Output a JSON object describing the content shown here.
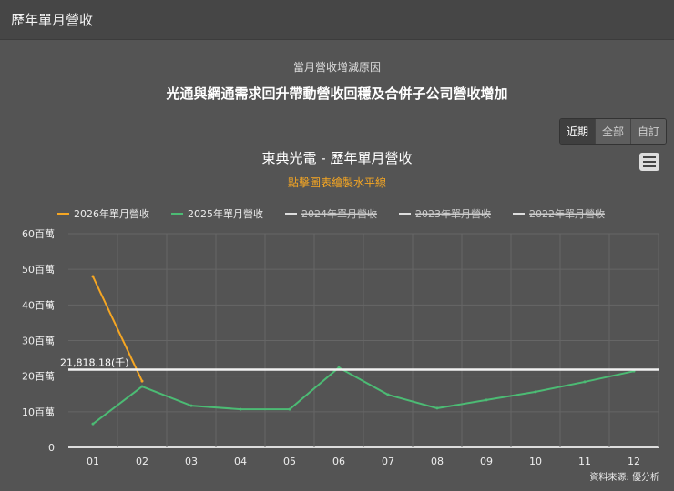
{
  "header": {
    "title": "歷年單月營收"
  },
  "subtitle": "當月營收增減原因",
  "reason": "光通與網通需求回升帶動營收回穩及合併子公司營收增加",
  "range_buttons": [
    "近期",
    "全部",
    "自訂"
  ],
  "chart_title": "東典光電 - 歷年單月營收",
  "chart_hint": "點擊圖表繪製水平線",
  "source": "資料來源: 優分析",
  "chart_data": {
    "type": "line",
    "categories": [
      "01",
      "02",
      "03",
      "04",
      "05",
      "06",
      "07",
      "08",
      "09",
      "10",
      "11",
      "12"
    ],
    "ylabel_unit": "百萬",
    "yticks": [
      "0",
      "10百萬",
      "20百萬",
      "30百萬",
      "40百萬",
      "50百萬",
      "60百萬"
    ],
    "ylim": [
      0,
      60
    ],
    "series": [
      {
        "name": "2026年單月營收",
        "color": "#f5a623",
        "visible": true,
        "values": [
          48.0,
          18.6,
          null,
          null,
          null,
          null,
          null,
          null,
          null,
          null,
          null,
          null
        ]
      },
      {
        "name": "2025年單月營收",
        "color": "#4cbb74",
        "visible": true,
        "values": [
          6.6,
          17.1,
          11.7,
          10.7,
          10.7,
          22.4,
          14.8,
          11.0,
          13.3,
          15.6,
          18.4,
          21.4
        ]
      },
      {
        "name": "2024年單月營收",
        "color": "#dddddd",
        "visible": false,
        "values": []
      },
      {
        "name": "2023年單月營收",
        "color": "#dddddd",
        "visible": false,
        "values": []
      },
      {
        "name": "2022年單月營收",
        "color": "#dddddd",
        "visible": false,
        "values": []
      }
    ],
    "hline": {
      "value": 21.81818,
      "label": "21,818.18(千)"
    }
  }
}
